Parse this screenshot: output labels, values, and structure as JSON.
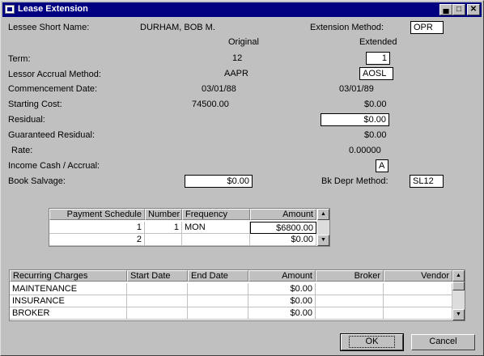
{
  "window": {
    "title": "Lease Extension"
  },
  "lessee": {
    "label": "Lessee Short Name:",
    "value": "DURHAM, BOB M."
  },
  "extension_method": {
    "label": "Extension Method:",
    "value": "OPR"
  },
  "columns": {
    "original": "Original",
    "extended": "Extended"
  },
  "fields": {
    "term": {
      "label": "Term:",
      "original": "12",
      "extended": "1"
    },
    "lessor_accrual": {
      "label": "Lessor Accrual Method:",
      "original": "AAPR",
      "extended": "AOSL"
    },
    "commencement": {
      "label": "Commencement Date:",
      "original": "03/01/88",
      "extended": "03/01/89"
    },
    "starting_cost": {
      "label": "Starting Cost:",
      "original": "74500.00",
      "extended": "$0.00"
    },
    "residual": {
      "label": "Residual:",
      "extended": "$0.00"
    },
    "guaranteed_residual": {
      "label": "Guaranteed Residual:",
      "extended": "$0.00"
    },
    "rate": {
      "label": "Rate:",
      "extended": "0.00000"
    },
    "income_cash": {
      "label": "Income Cash / Accrual:",
      "extended": "A"
    },
    "book_salvage": {
      "label": "Book Salvage:",
      "value": "$0.00"
    },
    "bk_depr": {
      "label": "Bk Depr Method:",
      "value": "SL12"
    }
  },
  "payment_schedule": {
    "headers": [
      "Payment Schedule",
      "Number",
      "Frequency",
      "Amount"
    ],
    "rows": [
      [
        "1",
        "1",
        "MON",
        "$6800.00"
      ],
      [
        "2",
        "",
        "",
        "$0.00"
      ]
    ]
  },
  "recurring": {
    "headers": [
      "Recurring Charges",
      "Start Date",
      "End Date",
      "Amount",
      "Broker",
      "Vendor"
    ],
    "rows": [
      [
        "MAINTENANCE",
        "",
        "",
        "$0.00",
        "",
        ""
      ],
      [
        "INSURANCE",
        "",
        "",
        "$0.00",
        "",
        ""
      ],
      [
        "BROKER",
        "",
        "",
        "$0.00",
        "",
        ""
      ]
    ]
  },
  "buttons": {
    "ok": "OK",
    "cancel": "Cancel"
  },
  "icons": {
    "minimize": "minimize-icon",
    "maximize": "maximize-icon",
    "close": "close-icon",
    "scroll_up": "scroll-up-icon",
    "scroll_down": "scroll-down-icon"
  }
}
